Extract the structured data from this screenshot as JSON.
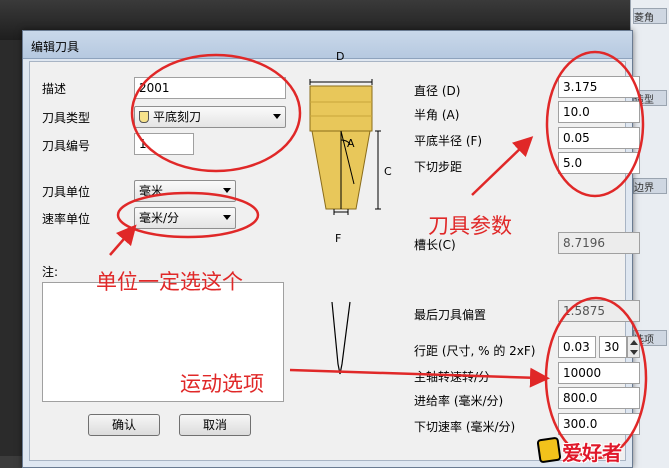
{
  "window": {
    "title": "编辑刀具"
  },
  "left": {
    "desc_label": "描述",
    "desc_value": "2001",
    "type_label": "刀具类型",
    "type_value": "平底刻刀",
    "num_label": "刀具编号",
    "num_value": "1",
    "unit_label": "刀具单位",
    "unit_value": "毫米",
    "rate_label": "速率单位",
    "rate_value": "毫米/分",
    "notes_label": "注:"
  },
  "diagram": {
    "label_d": "D",
    "label_a": "A",
    "label_c": "C",
    "label_f": "F"
  },
  "params": {
    "diameter_label": "直径 (D)",
    "diameter_value": "3.175",
    "half_angle_label": "半角 (A)",
    "half_angle_value": "10.0",
    "flat_radius_label": "平底半径 (F)",
    "flat_radius_value": "0.05",
    "stepdown_label": "下切步距",
    "stepdown_value": "5.0",
    "flute_label": "槽长(C)",
    "flute_value": "8.7196",
    "last_offset_label": "最后刀具偏置",
    "last_offset_value": "1.5875",
    "stepover_label": "行距 (尺寸, % 的 2xF)",
    "stepover_value": "0.03",
    "stepover_pct": "30",
    "spindle_label": "主轴转速转/分",
    "spindle_value": "10000",
    "feed_label": "进给率 (毫米/分)",
    "feed_value": "800.0",
    "plunge_label": "下切速率 (毫米/分)",
    "plunge_value": "300.0"
  },
  "buttons": {
    "ok": "确认",
    "cancel": "取消"
  },
  "annotations": {
    "tool_params": "刀具参数",
    "unit_note": "单位一定选这个",
    "motion_options": "运动选项"
  },
  "watermark": "爱好者",
  "background": {
    "tab1": "菱角",
    "tab2": "造型",
    "tab3": "边界",
    "tab4": "选项"
  },
  "colors": {
    "annotation": "#e02828",
    "tool_gold": "#e8c75a"
  }
}
